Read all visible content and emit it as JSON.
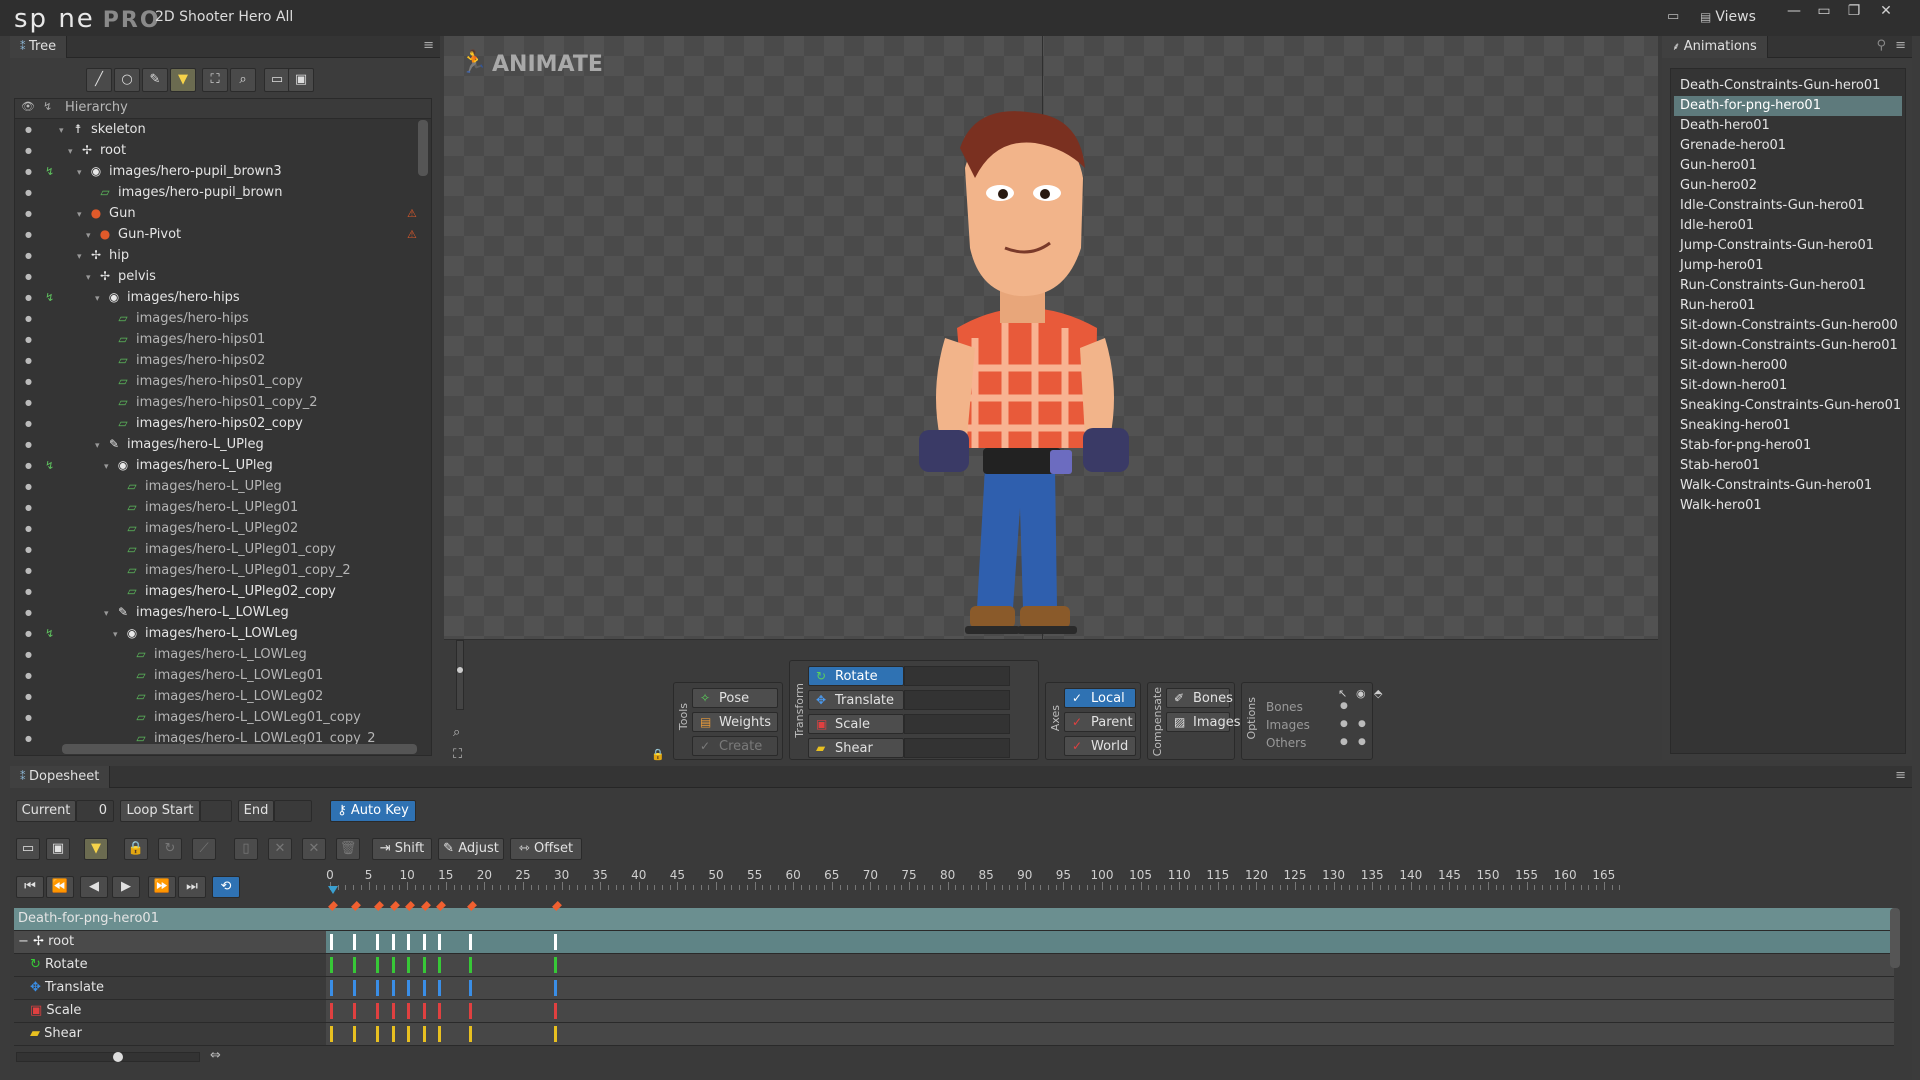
{
  "app": {
    "logo_text": "sp ne",
    "logo_pro": "PRO",
    "document_title": "2D Shooter Hero All",
    "views_label": "Views"
  },
  "tree_panel": {
    "tab_label": "Tree",
    "hierarchy_label": "Hierarchy",
    "toolbar_icons": [
      "bone-tool-icon",
      "circle-icon",
      "pen-icon",
      "filter-icon",
      "frame-icon",
      "search-icon",
      "copy-icon",
      "paste-icon"
    ],
    "rows": [
      {
        "label": "skeleton",
        "icon": "skeleton-icon",
        "indent": 0,
        "key": false,
        "dim": false
      },
      {
        "label": "root",
        "icon": "bone-icon",
        "indent": 1,
        "key": false,
        "dim": false
      },
      {
        "label": "images/hero-pupil_brown3",
        "icon": "slot-icon",
        "indent": 2,
        "key": true,
        "dim": false
      },
      {
        "label": "images/hero-pupil_brown",
        "icon": "attachment-icon",
        "indent": 3,
        "key": false,
        "dim": false
      },
      {
        "label": "Gun",
        "icon": "red-bone-icon",
        "indent": 2,
        "key": false,
        "dim": false
      },
      {
        "label": "Gun-Pivot",
        "icon": "red-bone-icon",
        "indent": 3,
        "key": false,
        "dim": false
      },
      {
        "label": "hip",
        "icon": "bone-icon",
        "indent": 2,
        "key": false,
        "dim": false
      },
      {
        "label": "pelvis",
        "icon": "bone-icon",
        "indent": 3,
        "key": false,
        "dim": false
      },
      {
        "label": "images/hero-hips",
        "icon": "slot-icon",
        "indent": 4,
        "key": true,
        "dim": false
      },
      {
        "label": "images/hero-hips",
        "icon": "attachment-icon",
        "indent": 5,
        "key": false,
        "dim": true
      },
      {
        "label": "images/hero-hips01",
        "icon": "attachment-icon",
        "indent": 5,
        "key": false,
        "dim": true
      },
      {
        "label": "images/hero-hips02",
        "icon": "attachment-icon",
        "indent": 5,
        "key": false,
        "dim": true
      },
      {
        "label": "images/hero-hips01_copy",
        "icon": "attachment-icon",
        "indent": 5,
        "key": false,
        "dim": true
      },
      {
        "label": "images/hero-hips01_copy_2",
        "icon": "attachment-icon",
        "indent": 5,
        "key": false,
        "dim": true
      },
      {
        "label": "images/hero-hips02_copy",
        "icon": "attachment-icon",
        "indent": 5,
        "key": false,
        "dim": false
      },
      {
        "label": "images/hero-L_UPleg",
        "icon": "pen-icon",
        "indent": 4,
        "key": false,
        "dim": false
      },
      {
        "label": "images/hero-L_UPleg",
        "icon": "slot-icon",
        "indent": 5,
        "key": true,
        "dim": false
      },
      {
        "label": "images/hero-L_UPleg",
        "icon": "attachment-icon",
        "indent": 6,
        "key": false,
        "dim": true
      },
      {
        "label": "images/hero-L_UPleg01",
        "icon": "attachment-icon",
        "indent": 6,
        "key": false,
        "dim": true
      },
      {
        "label": "images/hero-L_UPleg02",
        "icon": "attachment-icon",
        "indent": 6,
        "key": false,
        "dim": true
      },
      {
        "label": "images/hero-L_UPleg01_copy",
        "icon": "attachment-icon",
        "indent": 6,
        "key": false,
        "dim": true
      },
      {
        "label": "images/hero-L_UPleg01_copy_2",
        "icon": "attachment-icon",
        "indent": 6,
        "key": false,
        "dim": true
      },
      {
        "label": "images/hero-L_UPleg02_copy",
        "icon": "attachment-icon",
        "indent": 6,
        "key": false,
        "dim": false
      },
      {
        "label": "images/hero-L_LOWLeg",
        "icon": "pen-icon",
        "indent": 5,
        "key": false,
        "dim": false
      },
      {
        "label": "images/hero-L_LOWLeg",
        "icon": "slot-icon",
        "indent": 6,
        "key": true,
        "dim": false
      },
      {
        "label": "images/hero-L_LOWLeg",
        "icon": "attachment-icon",
        "indent": 7,
        "key": false,
        "dim": true
      },
      {
        "label": "images/hero-L_LOWLeg01",
        "icon": "attachment-icon",
        "indent": 7,
        "key": false,
        "dim": true
      },
      {
        "label": "images/hero-L_LOWLeg02",
        "icon": "attachment-icon",
        "indent": 7,
        "key": false,
        "dim": true
      },
      {
        "label": "images/hero-L_LOWLeg01_copy",
        "icon": "attachment-icon",
        "indent": 7,
        "key": false,
        "dim": true
      },
      {
        "label": "images/hero-L_LOWLeg01_copy_2",
        "icon": "attachment-icon",
        "indent": 7,
        "key": false,
        "dim": true
      }
    ]
  },
  "viewport": {
    "mode_label": "ANIMATE",
    "tools": {
      "group_label": "Tools",
      "pose": "Pose",
      "weights": "Weights",
      "create": "Create"
    },
    "transform": {
      "group_label": "Transform",
      "rotate": "Rotate",
      "translate": "Translate",
      "scale": "Scale",
      "shear": "Shear"
    },
    "axes": {
      "group_label": "Axes",
      "local": "Local",
      "parent": "Parent",
      "world": "World"
    },
    "compensate": {
      "group_label": "Compensate",
      "bones": "Bones",
      "images": "Images"
    },
    "options": {
      "group_label": "Options",
      "bones": "Bones",
      "images": "Images",
      "others": "Others"
    }
  },
  "animations_panel": {
    "tab_label": "Animations",
    "items": [
      "Death-Constraints-Gun-hero01",
      "Death-for-png-hero01",
      "Death-hero01",
      "Grenade-hero01",
      "Gun-hero01",
      "Gun-hero02",
      "Idle-Constraints-Gun-hero01",
      "Idle-hero01",
      "Jump-Constraints-Gun-hero01",
      "Jump-hero01",
      "Run-Constraints-Gun-hero01",
      "Run-hero01",
      "Sit-down-Constraints-Gun-hero00",
      "Sit-down-Constraints-Gun-hero01",
      "Sit-down-hero00",
      "Sit-down-hero01",
      "Sneaking-Constraints-Gun-hero01",
      "Sneaking-hero01",
      "Stab-for-png-hero01",
      "Stab-hero01",
      "Walk-Constraints-Gun-hero01",
      "Walk-hero01"
    ],
    "selected_index": 1
  },
  "dopesheet": {
    "tab_label": "Dopesheet",
    "current_label": "Current",
    "current_value": "0",
    "loop_start_label": "Loop Start",
    "end_label": "End",
    "auto_key_label": "Auto Key",
    "shift_label": "Shift",
    "adjust_label": "Adjust",
    "offset_label": "Offset",
    "ruler_ticks": [
      "0",
      "5",
      "10",
      "15",
      "20",
      "25",
      "30",
      "35",
      "40",
      "45",
      "50",
      "55",
      "60",
      "65",
      "70",
      "75",
      "80",
      "85",
      "90",
      "95",
      "100",
      "105",
      "110",
      "115",
      "120",
      "125",
      "130",
      "135",
      "140",
      "145",
      "150",
      "155",
      "160",
      "165"
    ],
    "rows": [
      {
        "label": "Death-for-png-hero01",
        "kind": "animation",
        "color": "#ffffff"
      },
      {
        "label": "root",
        "kind": "bone",
        "color": "#ffffff"
      },
      {
        "label": "Rotate",
        "kind": "rotate",
        "color": "#37c837"
      },
      {
        "label": "Translate",
        "kind": "translate",
        "color": "#3a8ee6"
      },
      {
        "label": "Scale",
        "kind": "scale",
        "color": "#e04040"
      },
      {
        "label": "Shear",
        "kind": "shear",
        "color": "#e8c020"
      }
    ],
    "key_frames": [
      0,
      3,
      6,
      8,
      10,
      12,
      14,
      18,
      29
    ]
  }
}
